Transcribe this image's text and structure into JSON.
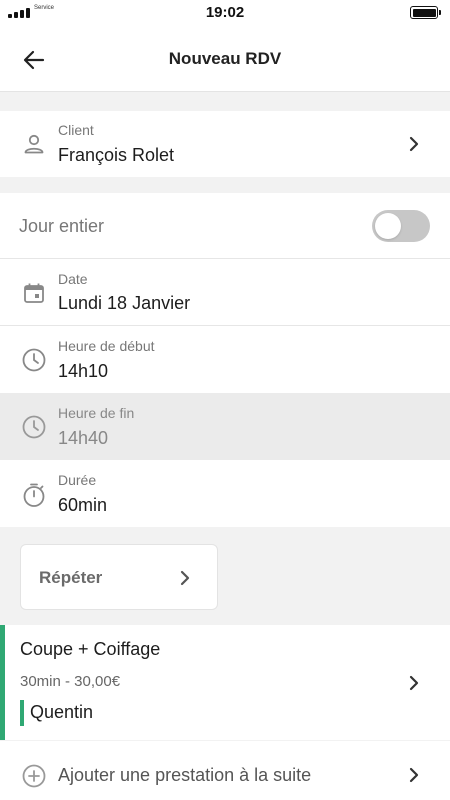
{
  "status_bar": {
    "carrier": "Service",
    "time": "19:02"
  },
  "header": {
    "title": "Nouveau RDV",
    "back_icon": "arrow-left-icon"
  },
  "client": {
    "label": "Client",
    "value": "François Rolet",
    "icon": "person-icon"
  },
  "all_day": {
    "label": "Jour entier",
    "enabled": false
  },
  "date": {
    "label": "Date",
    "value": "Lundi 18 Janvier",
    "icon": "calendar-icon"
  },
  "start_time": {
    "label": "Heure de début",
    "value": "14h10",
    "icon": "clock-icon"
  },
  "end_time": {
    "label": "Heure de fin",
    "value": "14h40",
    "icon": "clock-icon",
    "disabled": true
  },
  "duration": {
    "label": "Durée",
    "value": "60min",
    "icon": "stopwatch-icon"
  },
  "repeat": {
    "label": "Répéter"
  },
  "service": {
    "name": "Coupe + Coiffage",
    "details": "30min - 30,00€",
    "staff": "Quentin",
    "accent_color": "#2fa873"
  },
  "add_service": {
    "label": "Ajouter une prestation à la suite",
    "icon": "plus-circle-icon"
  },
  "colors": {
    "accent": "#2fa873",
    "disabled_row": "#ebebeb",
    "toggle_off": "#c7c7c7"
  }
}
